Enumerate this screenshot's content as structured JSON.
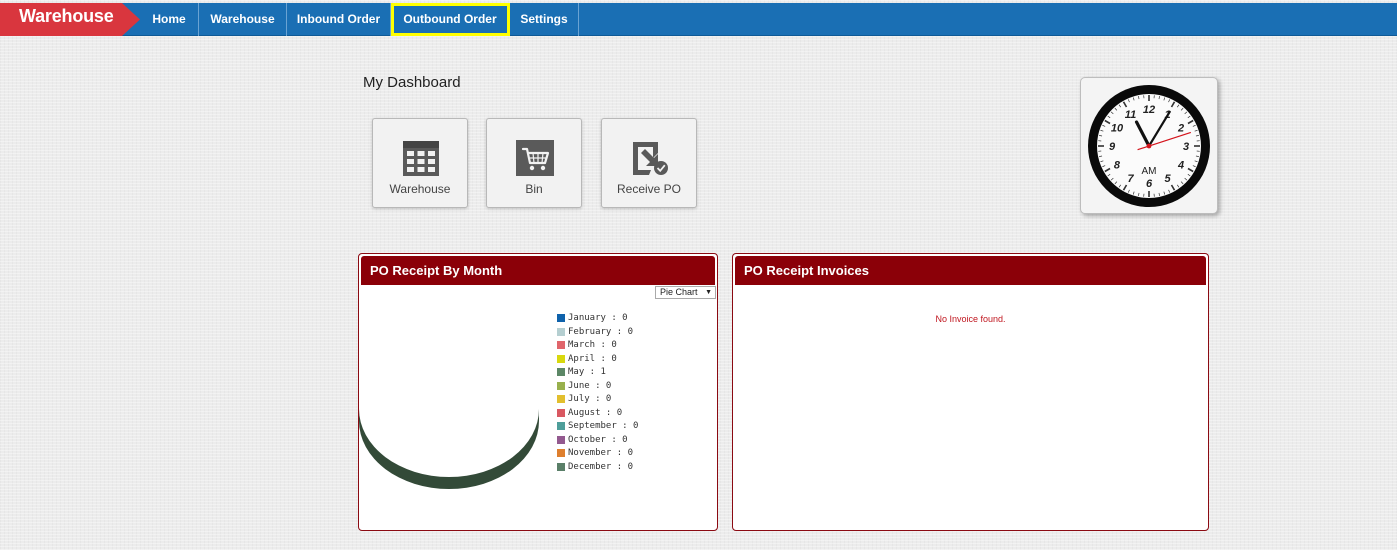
{
  "brand": "Warehouse",
  "nav": {
    "items": [
      {
        "label": "Home",
        "active": false
      },
      {
        "label": "Warehouse",
        "active": false
      },
      {
        "label": "Inbound Order",
        "active": false
      },
      {
        "label": "Outbound Order",
        "active": true
      },
      {
        "label": "Settings",
        "active": false
      }
    ]
  },
  "dashboard": {
    "title": "My Dashboard",
    "tiles": [
      {
        "label": "Warehouse",
        "icon": "table-grid-icon"
      },
      {
        "label": "Bin",
        "icon": "shopping-cart-icon"
      },
      {
        "label": "Receive PO",
        "icon": "receive-check-icon"
      }
    ]
  },
  "clock": {
    "meridiem": "AM",
    "numerals": [
      "12",
      "1",
      "2",
      "3",
      "4",
      "5",
      "6",
      "7",
      "8",
      "9",
      "10",
      "11"
    ],
    "hour": 11,
    "minute": 5,
    "second": 12
  },
  "receipt_panel": {
    "title": "PO Receipt By Month",
    "select_value": "Pie Chart"
  },
  "invoice_panel": {
    "title": "PO Receipt Invoices",
    "empty_text": "No Invoice found."
  },
  "chart_data": {
    "type": "pie",
    "categories": [
      "January",
      "February",
      "March",
      "April",
      "May",
      "June",
      "July",
      "August",
      "September",
      "October",
      "November",
      "December"
    ],
    "values": [
      0,
      0,
      0,
      0,
      1,
      0,
      0,
      0,
      0,
      0,
      0,
      0
    ],
    "legend_labels": [
      "January : 0",
      "February : 0",
      "March : 0",
      "April : 0",
      "May : 1",
      "June : 0",
      "July : 0",
      "August : 0",
      "September : 0",
      "October : 0",
      "November : 0",
      "December : 0"
    ],
    "colors": [
      "#0f62ab",
      "#b5cfd1",
      "#e0656b",
      "#d8d80e",
      "#5c8766",
      "#98b04d",
      "#e2bf2e",
      "#d95861",
      "#4e9e9a",
      "#93598f",
      "#de7f2e",
      "#5a7f68"
    ],
    "legend": "right"
  }
}
